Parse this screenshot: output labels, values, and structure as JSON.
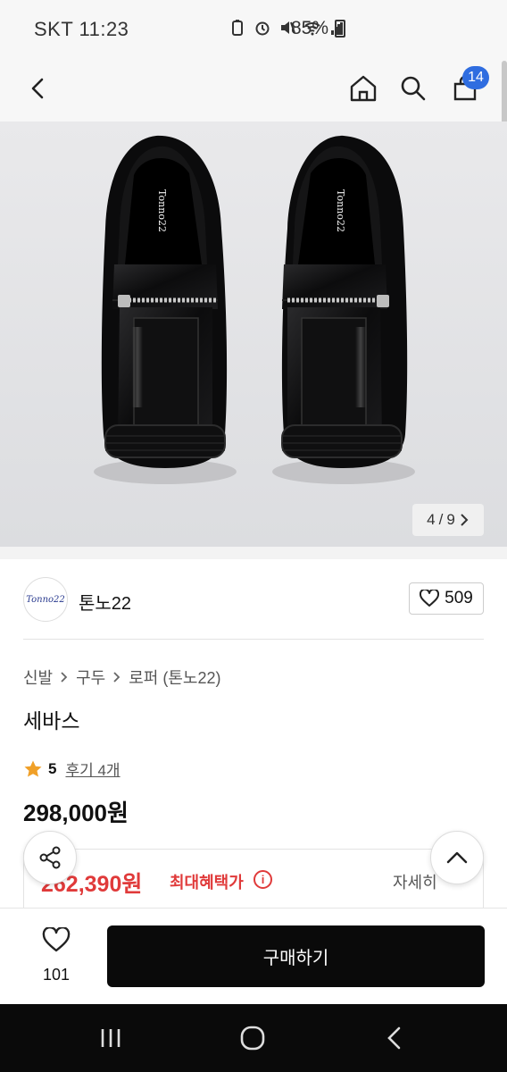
{
  "status_bar": {
    "carrier_time": "SKT 11:23",
    "battery": "85%"
  },
  "header": {
    "back_icon": "chevron-left-icon",
    "home_icon": "home-icon",
    "search_icon": "search-icon",
    "cart_icon": "shopping-bag-icon",
    "cart_count": "14"
  },
  "gallery": {
    "current": "4",
    "separator": "/",
    "total": "9",
    "next_icon": "chevron-right-icon"
  },
  "brand": {
    "logo_text": "Tonno22",
    "name": "톤노22",
    "like_count": "509"
  },
  "breadcrumb": {
    "items": [
      "신발",
      "구두",
      "로퍼 (톤노22)"
    ]
  },
  "product": {
    "title": "세바스",
    "rating": "5",
    "review_text": "후기 4개",
    "price": "298,000원"
  },
  "benefit": {
    "price": "262,390원",
    "label": "최대혜택가",
    "info_icon": "i",
    "detail": "자세히"
  },
  "action_bar": {
    "wish_count": "101",
    "buy_label": "구매하기"
  },
  "colors": {
    "accent_red": "#e03a3a",
    "badge_blue": "#2f6de0",
    "buy_black": "#0a0a0a"
  }
}
